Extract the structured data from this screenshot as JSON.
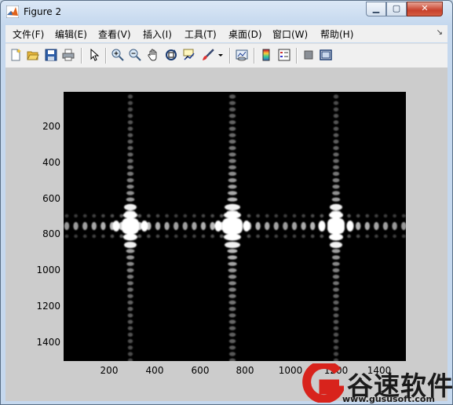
{
  "window": {
    "title": "Figure 2",
    "minimize_label": "▁",
    "maximize_label": "▢",
    "close_label": "✕"
  },
  "menubar": {
    "items": [
      "文件(F)",
      "编辑(E)",
      "查看(V)",
      "插入(I)",
      "工具(T)",
      "桌面(D)",
      "窗口(W)",
      "帮助(H)"
    ],
    "overflow": "↘"
  },
  "toolbar": {
    "icons": [
      "new-figure-icon",
      "open-file-icon",
      "save-icon",
      "print-icon",
      "pointer-icon",
      "zoom-in-icon",
      "zoom-out-icon",
      "pan-hand-icon",
      "rotate-3d-icon",
      "data-cursor-icon",
      "brush-icon",
      "link-plot-icon",
      "colorbar-icon",
      "legend-icon",
      "hide-plot-tools-icon",
      "show-plot-tools-icon"
    ]
  },
  "plot": {
    "yticks": [
      "200",
      "400",
      "600",
      "800",
      "1000",
      "1200",
      "1400"
    ],
    "xticks": [
      "200",
      "400",
      "600",
      "800",
      "1000",
      "1200",
      "1400"
    ],
    "colormap": "gray",
    "background": "#000000",
    "content": "diffraction pattern: bright horizontal band with three bright vertical columns"
  },
  "watermark": {
    "text": "谷速软件",
    "url": "www.gususoft.com",
    "accent": "#d8231c"
  }
}
